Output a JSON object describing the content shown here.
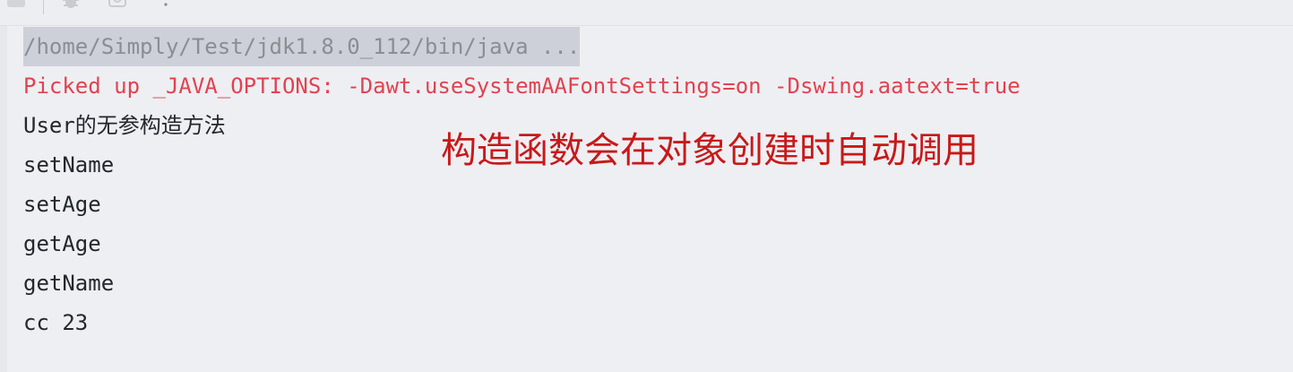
{
  "toolbar": {
    "icons": [
      "stop-icon",
      "debug-icon",
      "camera-icon",
      "more-icon"
    ]
  },
  "console": {
    "command": "/home/Simply/Test/jdk1.8.0_112/bin/java ...",
    "error_line": "Picked up _JAVA_OPTIONS: -Dawt.useSystemAAFontSettings=on -Dswing.aatext=true",
    "output": [
      "User的无参构造方法",
      "setName",
      "setAge",
      "getAge",
      "getName",
      "cc 23"
    ]
  },
  "annotation": {
    "text": "构造函数会在对象创建时自动调用"
  },
  "colors": {
    "background": "#eeeff3",
    "command_highlight": "#cdd0d8",
    "error_text": "#e0434f",
    "annotation_text": "#c81919",
    "output_text": "#23272e"
  }
}
